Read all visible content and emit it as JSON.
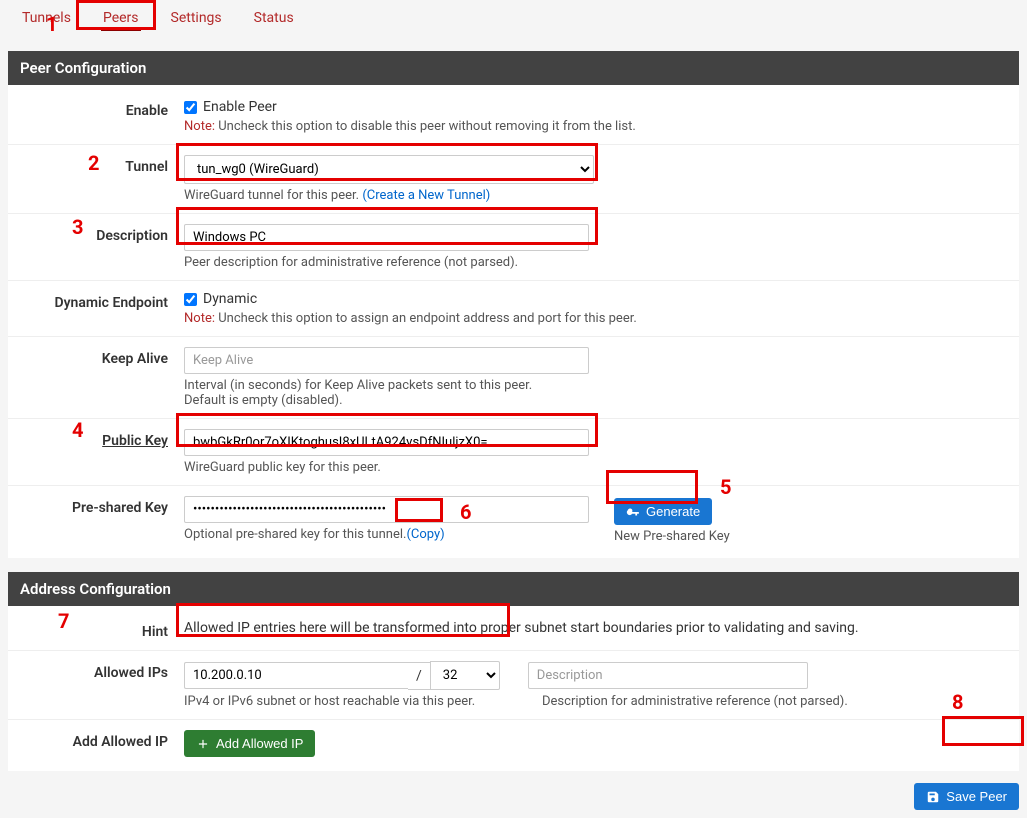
{
  "tabs": {
    "tunnels": "Tunnels",
    "peers": "Peers",
    "settings": "Settings",
    "status": "Status"
  },
  "section1": "Peer Configuration",
  "enable": {
    "label": "Enable",
    "checkbox_label": "Enable Peer",
    "note_label": "Note:",
    "note_text": " Uncheck this option to disable this peer without removing it from the list."
  },
  "tunnel": {
    "label": "Tunnel",
    "value": "tun_wg0 (WireGuard)",
    "help": "WireGuard tunnel for this peer. ",
    "link": "(Create a New Tunnel)"
  },
  "description": {
    "label": "Description",
    "value": "Windows PC",
    "help": "Peer description for administrative reference (not parsed)."
  },
  "dynamic": {
    "label": "Dynamic Endpoint",
    "checkbox_label": "Dynamic",
    "note_label": "Note:",
    "note_text": " Uncheck this option to assign an endpoint address and port for this peer."
  },
  "keepalive": {
    "label": "Keep Alive",
    "placeholder": "Keep Alive",
    "help1": "Interval (in seconds) for Keep Alive packets sent to this peer.",
    "help2": "Default is empty (disabled)."
  },
  "pubkey": {
    "label": "Public Key",
    "value": "bwbGkRr0or7oXIKtoghusI8xULtA924vsDfNIuljzX0=",
    "help": "WireGuard public key for this peer."
  },
  "psk": {
    "label": "Pre-shared Key",
    "value": "••••••••••••••••••••••••••••••••••••••••••••",
    "help": "Optional pre-shared key for this tunnel.",
    "copy": "(Copy)",
    "generate": "Generate",
    "gen_help": "New Pre-shared Key"
  },
  "section2": "Address Configuration",
  "hint": {
    "label": "Hint",
    "text": "Allowed IP entries here will be transformed into proper subnet start boundaries prior to validating and saving."
  },
  "allowed": {
    "label": "Allowed IPs",
    "ip": "10.200.0.10",
    "cidr": "32",
    "desc_placeholder": "Description",
    "help_left": "IPv4 or IPv6 subnet or host reachable via this peer.",
    "help_right": "Description for administrative reference (not parsed)."
  },
  "add": {
    "label": "Add Allowed IP",
    "button": "Add Allowed IP"
  },
  "save": "Save Peer",
  "annotations": {
    "n1": "1",
    "n2": "2",
    "n3": "3",
    "n4": "4",
    "n5": "5",
    "n6": "6",
    "n7": "7",
    "n8": "8"
  }
}
